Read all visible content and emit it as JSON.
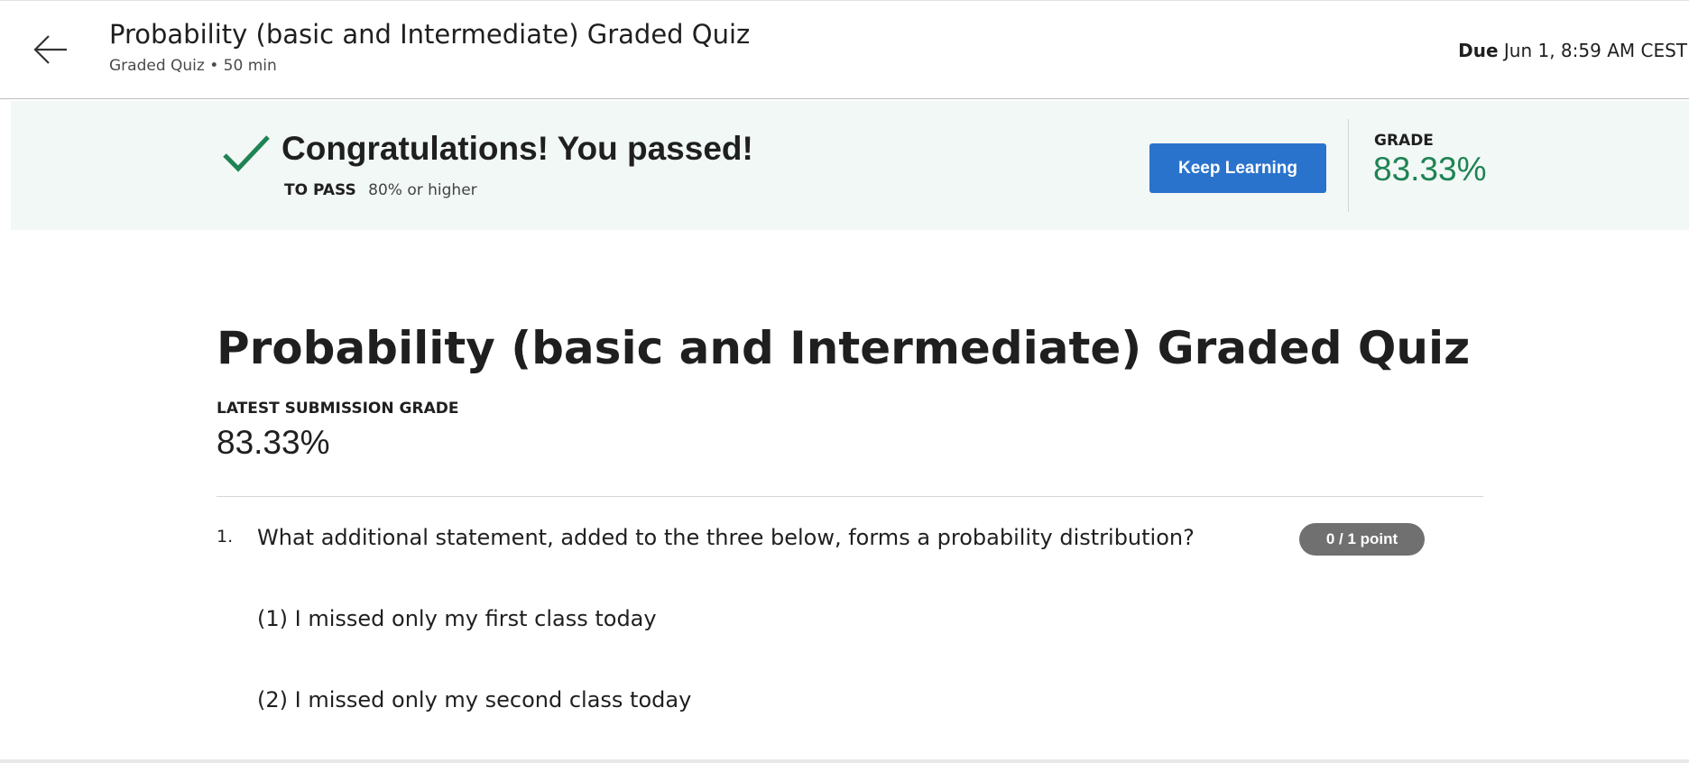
{
  "header": {
    "title": "Probability (basic and Intermediate) Graded Quiz",
    "subtitle": "Graded Quiz • 50 min",
    "due_label": "Due",
    "due_value": "Jun 1, 8:59 AM CEST",
    "back_icon": "arrow-left-icon"
  },
  "banner": {
    "title": "Congratulations! You passed!",
    "check_icon": "checkmark-icon",
    "check_color": "#1f8354",
    "to_pass_label": "TO PASS",
    "to_pass_value": "80% or higher",
    "keep_learning_label": "Keep Learning",
    "grade_label": "GRADE",
    "grade_value": "83.33%",
    "background_color": "#f2f8f5",
    "button_color": "#2a73cc",
    "grade_color": "#1f8354"
  },
  "main": {
    "title": "Probability (basic and Intermediate) Graded Quiz",
    "latest_label": "LATEST SUBMISSION GRADE",
    "latest_value": "83.33%"
  },
  "questions": [
    {
      "number": "1.",
      "text": "What additional statement, added to the three below, forms a probability distribution?",
      "points": "0 / 1 point",
      "statements": [
        "(1) I missed only my first class today",
        "(2) I missed only my second class today"
      ]
    }
  ]
}
